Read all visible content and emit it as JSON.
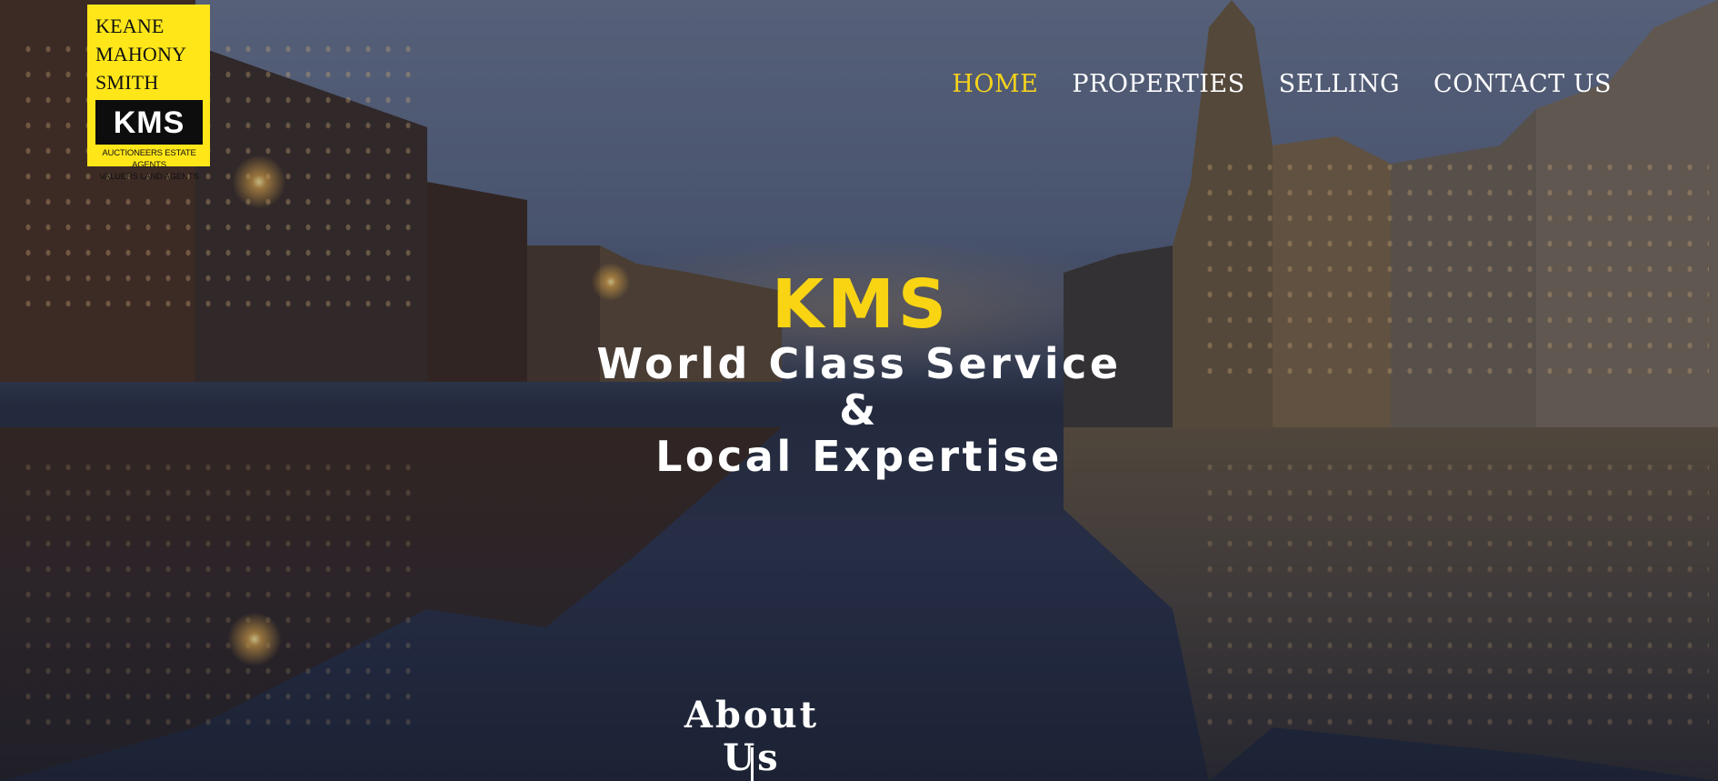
{
  "logo": {
    "line1": "KEANE",
    "line2": "MAHONY",
    "line3": "SMITH",
    "mark": "KMS",
    "sub1": "AUCTIONEERS  ESTATE AGENTS",
    "sub2": "VALUERS    LAND AGENTS"
  },
  "nav": {
    "items": [
      {
        "label": "HOME",
        "active": true
      },
      {
        "label": "PROPERTIES"
      },
      {
        "label": "SELLING"
      },
      {
        "label": "CONTACT US"
      }
    ]
  },
  "hero": {
    "brand": "KMS",
    "tagline_line1": "World Class Service",
    "tagline_line2": "&",
    "tagline_line3": "Local Expertise"
  },
  "section": {
    "about_title": "About Us"
  },
  "colors": {
    "accent": "#f5d21c",
    "logo_bg": "#ffe619",
    "text": "#ffffff"
  }
}
